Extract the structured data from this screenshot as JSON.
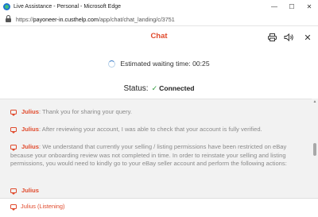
{
  "window": {
    "title": "Live Assistance - Personal - Microsoft Edge",
    "controls": {
      "minimize": "—",
      "maximize": "☐",
      "close": "✕"
    }
  },
  "address": {
    "url_prefix": "https://",
    "url_host": "payoneer-in.custhelp.com",
    "url_path": "/app/chat/chat_landing/c/3751"
  },
  "chat": {
    "title": "Chat",
    "icons": {
      "print": "print-icon",
      "sound": "speaker-icon",
      "close": "close-icon"
    },
    "close_glyph": "✕"
  },
  "waiting": {
    "label": "Estimated waiting time: 00:25"
  },
  "status": {
    "label": "Status:",
    "check": "✓",
    "value": "Connected"
  },
  "messages": [
    {
      "name": "Julius",
      "text": "Thank you for sharing your query."
    },
    {
      "name": "Julius",
      "text": "After reviewing your account, I was able to check that your account is fully verified."
    },
    {
      "name": "Julius",
      "text": "We understand that currently your selling / listing permissions have been restricted on eBay because your onboarding review was not completed in time. In order to reinstate your selling and listing permissions, you would need to kindly go to your eBay seller account and perform the following actions:"
    },
    {
      "name": "Julius",
      "text": ""
    }
  ],
  "footer": {
    "typing_status": "Julius (Listening)"
  },
  "colors": {
    "accent": "#e0492b",
    "success": "#2e9a3a",
    "transcript_bg": "#f2f2f2"
  }
}
